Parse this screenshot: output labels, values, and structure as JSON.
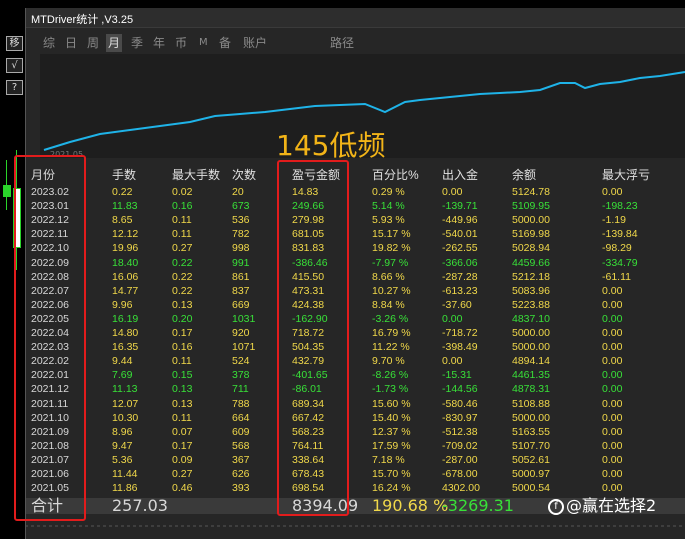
{
  "window": {
    "title": "MTDriver统计 ,V3.25"
  },
  "left_tools": [
    "移",
    "√",
    "?"
  ],
  "tabs": [
    "综",
    "日",
    "周",
    "月",
    "季",
    "年",
    "币",
    "M",
    "备",
    "账户",
    "路径"
  ],
  "active_tab": "月",
  "chart": {
    "x_start_label": "2021.05",
    "line_color": "#1fb3e8"
  },
  "overlay_title": "145低频",
  "columns": [
    "月份",
    "手数",
    "最大手数",
    "次数",
    "盈亏金额",
    "百分比%",
    "出入金",
    "余额",
    "最大浮亏"
  ],
  "rows": [
    {
      "month": "2023.02",
      "lots": "0.22",
      "max": "0.02",
      "cnt": "20",
      "pl": "14.83",
      "pct": "0.29 %",
      "flow": "0.00",
      "bal": "5124.78",
      "float": "0.00",
      "c": "y"
    },
    {
      "month": "2023.01",
      "lots": "11.83",
      "max": "0.16",
      "cnt": "673",
      "pl": "249.66",
      "pct": "5.14 %",
      "flow": "-139.71",
      "bal": "5109.95",
      "float": "-198.23",
      "c": "g"
    },
    {
      "month": "2022.12",
      "lots": "8.65",
      "max": "0.11",
      "cnt": "536",
      "pl": "279.98",
      "pct": "5.93 %",
      "flow": "-449.96",
      "bal": "5000.00",
      "float": "-1.19",
      "c": "y"
    },
    {
      "month": "2022.11",
      "lots": "12.12",
      "max": "0.11",
      "cnt": "782",
      "pl": "681.05",
      "pct": "15.17 %",
      "flow": "-540.01",
      "bal": "5169.98",
      "float": "-139.84",
      "c": "y"
    },
    {
      "month": "2022.10",
      "lots": "19.96",
      "max": "0.27",
      "cnt": "998",
      "pl": "831.83",
      "pct": "19.82 %",
      "flow": "-262.55",
      "bal": "5028.94",
      "float": "-98.29",
      "c": "y"
    },
    {
      "month": "2022.09",
      "lots": "18.40",
      "max": "0.22",
      "cnt": "991",
      "pl": "-386.46",
      "pct": "-7.97 %",
      "flow": "-366.06",
      "bal": "4459.66",
      "float": "-334.79",
      "c": "g"
    },
    {
      "month": "2022.08",
      "lots": "16.06",
      "max": "0.22",
      "cnt": "861",
      "pl": "415.50",
      "pct": "8.66 %",
      "flow": "-287.28",
      "bal": "5212.18",
      "float": "-61.11",
      "c": "y"
    },
    {
      "month": "2022.07",
      "lots": "14.77",
      "max": "0.22",
      "cnt": "837",
      "pl": "473.31",
      "pct": "10.27 %",
      "flow": "-613.23",
      "bal": "5083.96",
      "float": "0.00",
      "c": "y"
    },
    {
      "month": "2022.06",
      "lots": "9.96",
      "max": "0.13",
      "cnt": "669",
      "pl": "424.38",
      "pct": "8.84 %",
      "flow": "-37.60",
      "bal": "5223.88",
      "float": "0.00",
      "c": "y"
    },
    {
      "month": "2022.05",
      "lots": "16.19",
      "max": "0.20",
      "cnt": "1031",
      "pl": "-162.90",
      "pct": "-3.26 %",
      "flow": "0.00",
      "bal": "4837.10",
      "float": "0.00",
      "c": "g"
    },
    {
      "month": "2022.04",
      "lots": "14.80",
      "max": "0.17",
      "cnt": "920",
      "pl": "718.72",
      "pct": "16.79 %",
      "flow": "-718.72",
      "bal": "5000.00",
      "float": "0.00",
      "c": "y"
    },
    {
      "month": "2022.03",
      "lots": "16.35",
      "max": "0.16",
      "cnt": "1071",
      "pl": "504.35",
      "pct": "11.22 %",
      "flow": "-398.49",
      "bal": "5000.00",
      "float": "0.00",
      "c": "y"
    },
    {
      "month": "2022.02",
      "lots": "9.44",
      "max": "0.11",
      "cnt": "524",
      "pl": "432.79",
      "pct": "9.70 %",
      "flow": "0.00",
      "bal": "4894.14",
      "float": "0.00",
      "c": "y"
    },
    {
      "month": "2022.01",
      "lots": "7.69",
      "max": "0.15",
      "cnt": "378",
      "pl": "-401.65",
      "pct": "-8.26 %",
      "flow": "-15.31",
      "bal": "4461.35",
      "float": "0.00",
      "c": "g"
    },
    {
      "month": "2021.12",
      "lots": "11.13",
      "max": "0.13",
      "cnt": "711",
      "pl": "-86.01",
      "pct": "-1.73 %",
      "flow": "-144.56",
      "bal": "4878.31",
      "float": "0.00",
      "c": "g"
    },
    {
      "month": "2021.11",
      "lots": "12.07",
      "max": "0.13",
      "cnt": "788",
      "pl": "689.34",
      "pct": "15.60 %",
      "flow": "-580.46",
      "bal": "5108.88",
      "float": "0.00",
      "c": "y"
    },
    {
      "month": "2021.10",
      "lots": "10.30",
      "max": "0.11",
      "cnt": "664",
      "pl": "667.42",
      "pct": "15.40 %",
      "flow": "-830.97",
      "bal": "5000.00",
      "float": "0.00",
      "c": "y"
    },
    {
      "month": "2021.09",
      "lots": "8.96",
      "max": "0.07",
      "cnt": "609",
      "pl": "568.23",
      "pct": "12.37 %",
      "flow": "-512.38",
      "bal": "5163.55",
      "float": "0.00",
      "c": "y"
    },
    {
      "month": "2021.08",
      "lots": "9.47",
      "max": "0.17",
      "cnt": "568",
      "pl": "764.11",
      "pct": "17.59 %",
      "flow": "-709.02",
      "bal": "5107.70",
      "float": "0.00",
      "c": "y"
    },
    {
      "month": "2021.07",
      "lots": "5.36",
      "max": "0.09",
      "cnt": "367",
      "pl": "338.64",
      "pct": "7.18 %",
      "flow": "-287.00",
      "bal": "5052.61",
      "float": "0.00",
      "c": "y"
    },
    {
      "month": "2021.06",
      "lots": "11.44",
      "max": "0.27",
      "cnt": "626",
      "pl": "678.43",
      "pct": "15.70 %",
      "flow": "-678.00",
      "bal": "5000.97",
      "float": "0.00",
      "c": "y"
    },
    {
      "month": "2021.05",
      "lots": "11.86",
      "max": "0.46",
      "cnt": "393",
      "pl": "698.54",
      "pct": "16.24 %",
      "flow": "4302.00",
      "bal": "5000.54",
      "float": "0.00",
      "c": "y"
    }
  ],
  "total": {
    "label": "合计",
    "lots": "257.03",
    "pl": "8394.09",
    "pct": "190.68 %",
    "flow": "-3269.31"
  },
  "watermark": {
    "logo": "f",
    "text": "@赢在选择2"
  },
  "colors": {
    "positive": "#f0d84a",
    "negative": "#38e038",
    "highlight": "#e21c1c",
    "accent": "#f2b418"
  }
}
